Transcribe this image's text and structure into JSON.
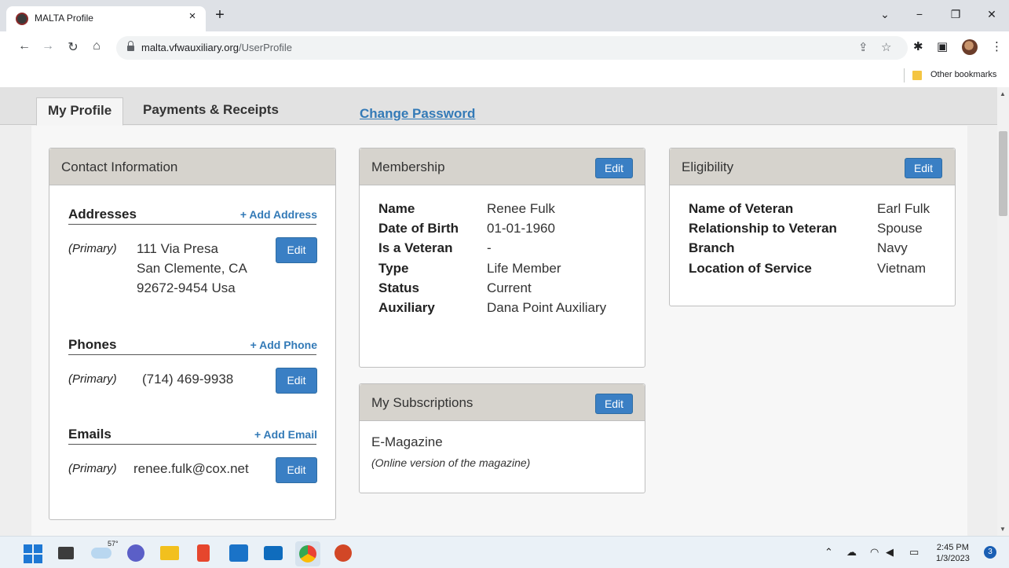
{
  "browser": {
    "tab_title": "MALTA Profile",
    "tab_close": "×",
    "new_tab": "+",
    "url_domain": "malta.vfwauxiliary.org",
    "url_path": "/UserProfile",
    "bookmark_folder": "Other bookmarks"
  },
  "page_tabs": {
    "my_profile": "My Profile",
    "payments": "Payments & Receipts",
    "change_password": "Change Password"
  },
  "contact": {
    "title": "Contact Information",
    "addresses_title": "Addresses",
    "add_address": "+ Add Address",
    "address_primary": "(Primary)",
    "address_line1": "111 Via Presa",
    "address_line2": "San Clemente, CA",
    "address_line3": "92672-9454 Usa",
    "phones_title": "Phones",
    "add_phone": "+ Add Phone",
    "phone_primary": "(Primary)",
    "phone_value": "(714) 469-9938",
    "emails_title": "Emails",
    "add_email": "+ Add Email",
    "email_primary": "(Primary)",
    "email_value": "renee.fulk@cox.net",
    "edit_label": "Edit"
  },
  "membership": {
    "title": "Membership",
    "edit_label": "Edit",
    "fields": [
      {
        "label": "Name",
        "value": "Renee Fulk"
      },
      {
        "label": "Date of Birth",
        "value": "01-01-1960"
      },
      {
        "label": "Is a Veteran",
        "value": "-"
      },
      {
        "label": "Type",
        "value": "Life Member"
      },
      {
        "label": "Status",
        "value": "Current"
      },
      {
        "label": "Auxiliary",
        "value": "Dana Point Auxiliary"
      }
    ]
  },
  "subscriptions": {
    "title": "My Subscriptions",
    "edit_label": "Edit",
    "item_name": "E-Magazine",
    "item_desc": "(Online version of the magazine)"
  },
  "eligibility": {
    "title": "Eligibility",
    "edit_label": "Edit",
    "fields": [
      {
        "label": "Name of Veteran",
        "value": "Earl Fulk"
      },
      {
        "label": "Relationship to Veteran",
        "value": "Spouse"
      },
      {
        "label": "Branch",
        "value": "Navy"
      },
      {
        "label": "Location of Service",
        "value": "Vietnam"
      }
    ]
  },
  "taskbar": {
    "weather_temp": "57°",
    "time": "2:45 PM",
    "date": "1/3/2023",
    "notifications": "3"
  },
  "colors": {
    "accent_blue": "#3a7fc4",
    "link_blue": "#337ab7",
    "panel_header": "#d6d3cd"
  }
}
